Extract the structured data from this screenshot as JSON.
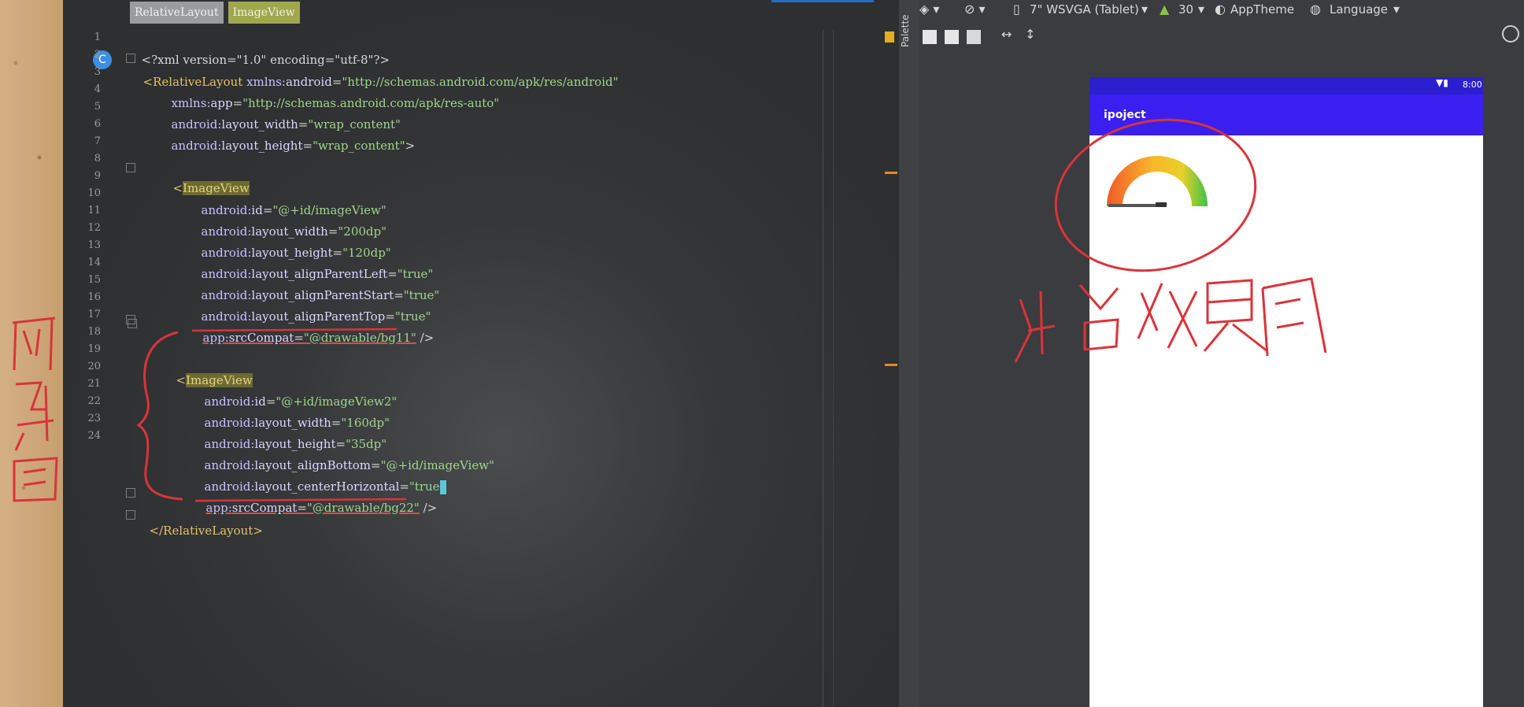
{
  "tabs": [
    "RelativeLayout",
    "ImageView"
  ],
  "editor": {
    "line_numbers": [
      "1",
      "2",
      "3",
      "4",
      "5",
      "6",
      "7",
      "8",
      "9",
      "10",
      "11",
      "12",
      "13",
      "14",
      "15",
      "16",
      "17",
      "18",
      "19",
      "20",
      "21",
      "22",
      "23",
      "24"
    ],
    "badge": "C",
    "code": {
      "l1": {
        "text": "<?xml version=\"1.0\" encoding=\"utf-8\"?>"
      },
      "l2": {
        "tag": "<RelativeLayout",
        "ns": "xmlns:",
        "attr": "android",
        "eq": "=",
        "val": "\"http://schemas.android.com/apk/res/android\""
      },
      "l3": {
        "ns": "xmlns:",
        "attr": "app",
        "eq": "=",
        "val": "\"http://schemas.android.com/apk/res-auto\""
      },
      "l4": {
        "ns": "android:",
        "attr": "layout_width",
        "eq": "=",
        "val": "\"wrap_content\""
      },
      "l5": {
        "ns": "android:",
        "attr": "layout_height",
        "eq": "=",
        "val": "\"wrap_content\"",
        "end": ">"
      },
      "l7": {
        "lt": "<",
        "tag": "ImageView"
      },
      "l8": {
        "ns": "android:",
        "attr": "id",
        "eq": "=",
        "val": "\"@+id/imageView\""
      },
      "l9": {
        "ns": "android:",
        "attr": "layout_width",
        "eq": "=",
        "val": "\"200dp\""
      },
      "l10": {
        "ns": "android:",
        "attr": "layout_height",
        "eq": "=",
        "val": "\"120dp\""
      },
      "l11": {
        "ns": "android:",
        "attr": "layout_alignParentLeft",
        "eq": "=",
        "val": "\"true\""
      },
      "l12": {
        "ns": "android:",
        "attr": "layout_alignParentStart",
        "eq": "=",
        "val": "\"true\""
      },
      "l13": {
        "ns": "android:",
        "attr": "layout_alignParentTop",
        "eq": "=",
        "val": "\"true\""
      },
      "l14": {
        "ns": "app:",
        "attr": "srcCompat",
        "eq": "=",
        "val": "\"@drawable/bg11\"",
        "end": " />"
      },
      "l16": {
        "lt": "<",
        "tag": "ImageView"
      },
      "l17": {
        "ns": "android:",
        "attr": "id",
        "eq": "=",
        "val": "\"@+id/imageView2\""
      },
      "l18": {
        "ns": "android:",
        "attr": "layout_width",
        "eq": "=",
        "val": "\"160dp\""
      },
      "l19": {
        "ns": "android:",
        "attr": "layout_height",
        "eq": "=",
        "val": "\"35dp\""
      },
      "l20": {
        "ns": "android:",
        "attr": "layout_alignBottom",
        "eq": "=",
        "val": "\"@+id/imageView\""
      },
      "l21": {
        "ns": "android:",
        "attr": "layout_centerHorizontal",
        "eq": "=",
        "val_a": "\"",
        "val_b": "true",
        "val_c": "\""
      },
      "l22": {
        "ns": "app:",
        "attr": "srcCompat",
        "eq": "=",
        "val": "\"@drawable/bg22\"",
        "end": " />"
      },
      "l23": {
        "tag": "</RelativeLayout>"
      }
    }
  },
  "design_toolbar": {
    "palette_label": "Palette",
    "device": "7\" WSVGA (Tablet)",
    "api": "30",
    "theme": "AppTheme",
    "language": "Language"
  },
  "device_preview": {
    "status_time": "8:00",
    "app_title": "ipoject"
  },
  "colors": {
    "editor_bg": "#2b2d2f",
    "app_bar": "#3a1ff0",
    "status_bar": "#2b1fcf",
    "annotation_red": "#d9343a"
  }
}
